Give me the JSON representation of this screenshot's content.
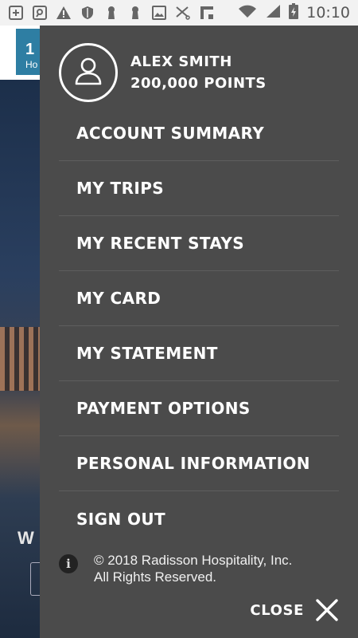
{
  "status_bar": {
    "time": "10:10",
    "left_icons": [
      "add-box-icon",
      "search-app-icon",
      "warning-icon",
      "shield-icon",
      "keyhole-icon",
      "keyhole-icon",
      "image-icon",
      "scissors-icon",
      "flipboard-icon"
    ],
    "right_icons": [
      "wifi-icon",
      "signal-icon",
      "battery-charging-icon"
    ]
  },
  "background": {
    "badge_text": "1",
    "badge_sub": "Ho",
    "welcome_fragment": "W"
  },
  "drawer": {
    "user_name": "ALEX SMITH",
    "points": "200,000 POINTS",
    "menu": [
      {
        "label": "ACCOUNT SUMMARY"
      },
      {
        "label": "MY TRIPS"
      },
      {
        "label": "MY RECENT STAYS"
      },
      {
        "label": "MY CARD"
      },
      {
        "label": "MY STATEMENT"
      },
      {
        "label": "PAYMENT OPTIONS"
      },
      {
        "label": "PERSONAL INFORMATION"
      },
      {
        "label": "SIGN OUT"
      }
    ],
    "copyright_line1": "© 2018 Radisson Hospitality, Inc.",
    "copyright_line2": "All Rights Reserved.",
    "close_label": "CLOSE"
  },
  "colors": {
    "drawer_bg": "#4b4b4b",
    "status_bar_bg": "#f2f2f2",
    "accent_blue": "#2e7ea3"
  }
}
